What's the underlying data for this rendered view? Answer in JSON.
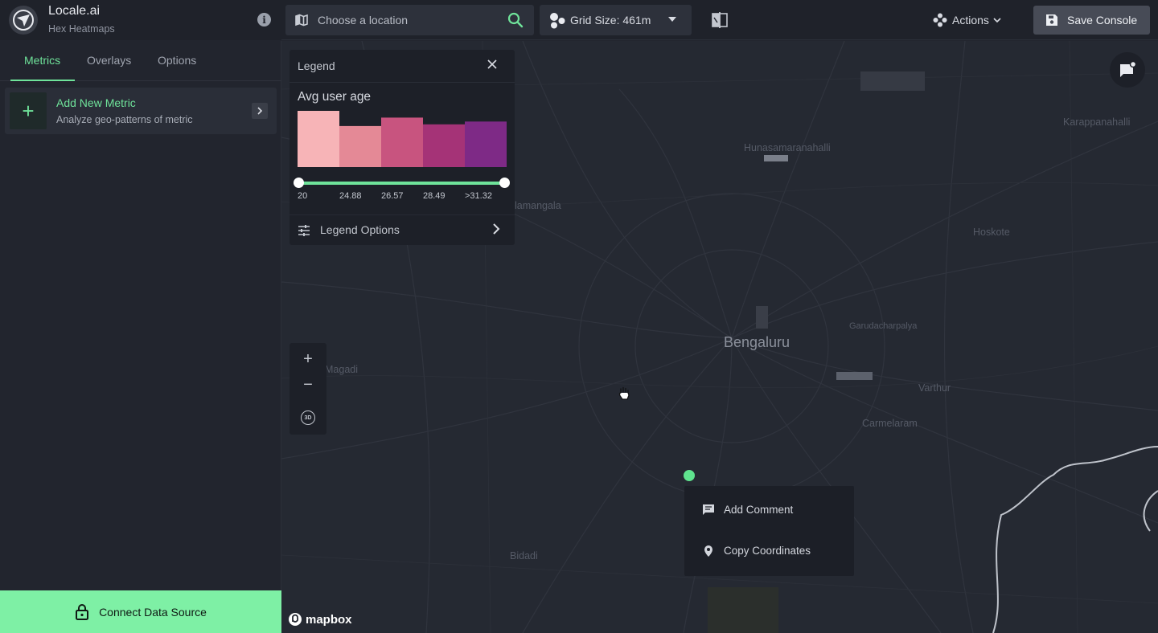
{
  "brand": {
    "name": "Locale.ai",
    "subtitle": "Hex Heatmaps"
  },
  "location": {
    "placeholder": "Choose a location"
  },
  "grid": {
    "label": "Grid Size: 461m"
  },
  "actions": {
    "label": "Actions"
  },
  "save": {
    "label": "Save Console"
  },
  "tabs": [
    {
      "label": "Metrics",
      "active": true
    },
    {
      "label": "Overlays"
    },
    {
      "label": "Options"
    }
  ],
  "metric_card": {
    "title": "Add New Metric",
    "description": "Analyze geo-patterns of metric"
  },
  "connect": {
    "label": "Connect Data Source"
  },
  "legend": {
    "title": "Legend",
    "metric": "Avg user age",
    "ticks": [
      "20",
      "24.88",
      "26.57",
      "28.49",
      ">31.32"
    ],
    "bars": [
      {
        "value": 1.0,
        "color": "#f7b4b7"
      },
      {
        "value": 0.73,
        "color": "#e48996"
      },
      {
        "value": 0.88,
        "color": "#c8547f"
      },
      {
        "value": 0.76,
        "color": "#a53377"
      },
      {
        "value": 0.81,
        "color": "#7e2a86"
      }
    ],
    "options_label": "Legend Options"
  },
  "map": {
    "city": "Bengaluru",
    "places": [
      "Hunasamaranahalli",
      "Karappanahalli",
      "Hoskote",
      "Garudacharpalya",
      "Varthur",
      "Carmelaram",
      "Bidadi",
      "Magadi",
      "Nelamangala"
    ],
    "attribution": "mapbox"
  },
  "context_menu": [
    {
      "label": "Add Comment",
      "icon": "comment-icon"
    },
    {
      "label": "Copy Coordinates",
      "icon": "location-pin-icon"
    }
  ],
  "colors": {
    "accent": "#6fe39a",
    "connect_bg": "#7ef0a5",
    "panel": "#1d2028",
    "map_bg": "#252932"
  }
}
